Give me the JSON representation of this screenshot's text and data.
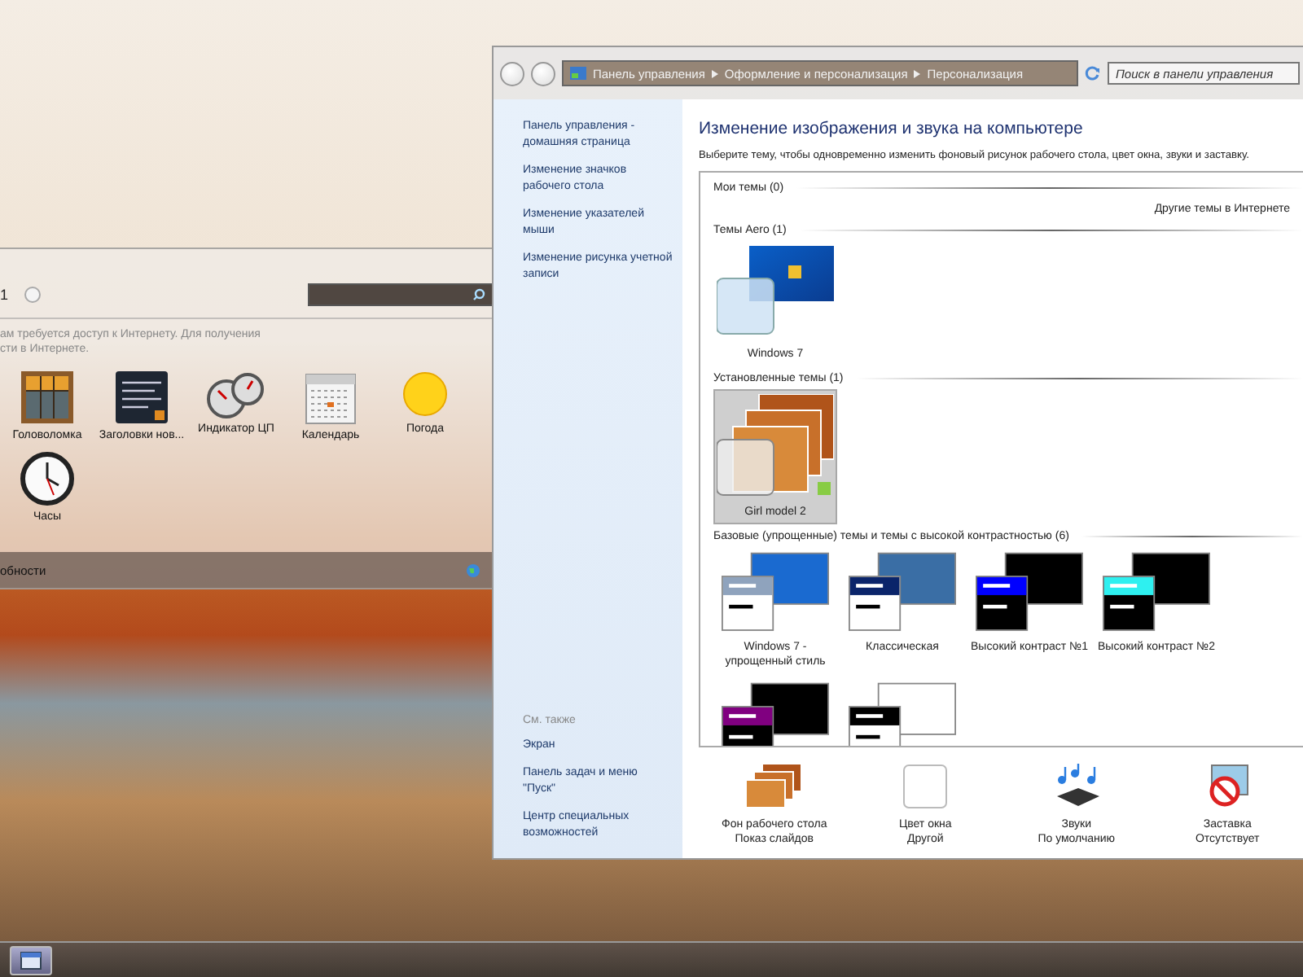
{
  "gadgets_window": {
    "page": "1",
    "notice": [
      "ам требуется доступ к Интернету. Для получения",
      "сти в Интернете."
    ],
    "gadgets": [
      {
        "kind": "puzzle",
        "label": "Головоломка"
      },
      {
        "kind": "news",
        "label": "Заголовки нов..."
      },
      {
        "kind": "cpu",
        "label": "Индикатор ЦП"
      },
      {
        "kind": "calendar",
        "label": "Календарь"
      },
      {
        "kind": "weather",
        "label": "Погода"
      },
      {
        "kind": "clock",
        "label": "Часы"
      }
    ],
    "footer_link": "обности"
  },
  "window": {
    "breadcrumbs": [
      "Панель управления",
      "Оформление и персонализация",
      "Персонализация"
    ],
    "search": {
      "placeholder": "Поиск в панели управления"
    },
    "sidebar": {
      "links": [
        "Панель управления - домашняя страница",
        "Изменение значков рабочего стола",
        "Изменение указателей мыши",
        "Изменение рисунка учетной записи"
      ],
      "see_also_title": "См. также",
      "see_also": [
        "Экран",
        "Панель задач и меню \"Пуск\"",
        "Центр специальных возможностей"
      ]
    },
    "title": "Изменение изображения и звука на компьютере",
    "description": "Выберите тему, чтобы одновременно изменить фоновый рисунок рабочего стола, цвет окна, звуки и заставку.",
    "groups": [
      {
        "title": "Мои темы (0)",
        "link": "Другие темы в Интернете"
      },
      {
        "title": "Темы Aero (1)",
        "themes": [
          {
            "kind": "aero",
            "label": "Windows 7",
            "selected": false
          }
        ]
      },
      {
        "title": "Установленные темы (1)",
        "themes": [
          {
            "kind": "photo",
            "label": "Girl model 2",
            "selected": true
          }
        ]
      },
      {
        "title": "Базовые (упрощенные) темы и темы с высокой контрастностью (6)",
        "themes": [
          {
            "kind": "basic-aero",
            "color": "#8fa3bd",
            "label": "Windows 7 - упрощенный стиль",
            "selected": false
          },
          {
            "kind": "classic",
            "color": "#0a246a",
            "label": "Классическая",
            "selected": false
          },
          {
            "kind": "contrast",
            "color": "#0000ff",
            "label": "Высокий контраст №1",
            "selected": false
          },
          {
            "kind": "contrast",
            "color": "#2ef0f0",
            "label": "Высокий контраст №2",
            "selected": false
          },
          {
            "kind": "contrast",
            "color": "#800080",
            "selected": false
          },
          {
            "kind": "contrast-white",
            "color": "#000000",
            "selected": false
          }
        ]
      }
    ],
    "settings": [
      {
        "kind": "wallpaper",
        "label": "Фон рабочего стола",
        "value": "Показ слайдов"
      },
      {
        "kind": "color",
        "label": "Цвет окна",
        "value": "Другой"
      },
      {
        "kind": "sounds",
        "label": "Звуки",
        "value": "По умолчанию"
      },
      {
        "kind": "screensaver",
        "label": "Заставка",
        "value": "Отсутствует"
      }
    ]
  }
}
